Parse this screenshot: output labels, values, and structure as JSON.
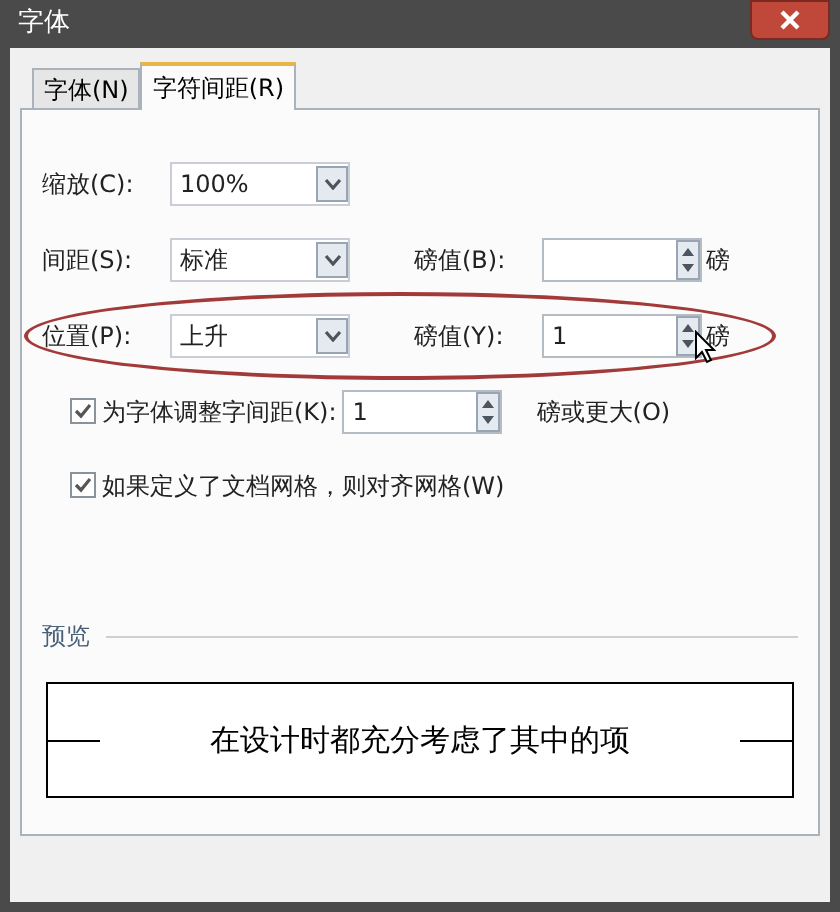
{
  "window": {
    "title": "字体"
  },
  "tabs": [
    {
      "label": "字体(N)",
      "selected": false
    },
    {
      "label": "字符间距(R)",
      "selected": true
    }
  ],
  "rows": [
    {
      "label": "缩放(C):",
      "dropdown": "100%"
    },
    {
      "label": "间距(S):",
      "dropdown": "标准",
      "points_label": "磅值(B):",
      "unit": "磅",
      "highlighted": false
    },
    {
      "label": "位置(P):",
      "dropdown": "上升",
      "points_label": "磅值(Y):",
      "points_value": "1",
      "unit": "磅",
      "highlighted": true
    }
  ],
  "checkboxes": [
    {
      "label": "为字体调整字间距(K):",
      "checked": true,
      "value": "1",
      "suffix": "磅或更大(O)"
    },
    {
      "label": "如果定义了文档网格，则对齐网格(W)",
      "checked": true
    }
  ],
  "preview": {
    "label": "预览",
    "text": "在设计时都充分考虑了其中的项"
  }
}
